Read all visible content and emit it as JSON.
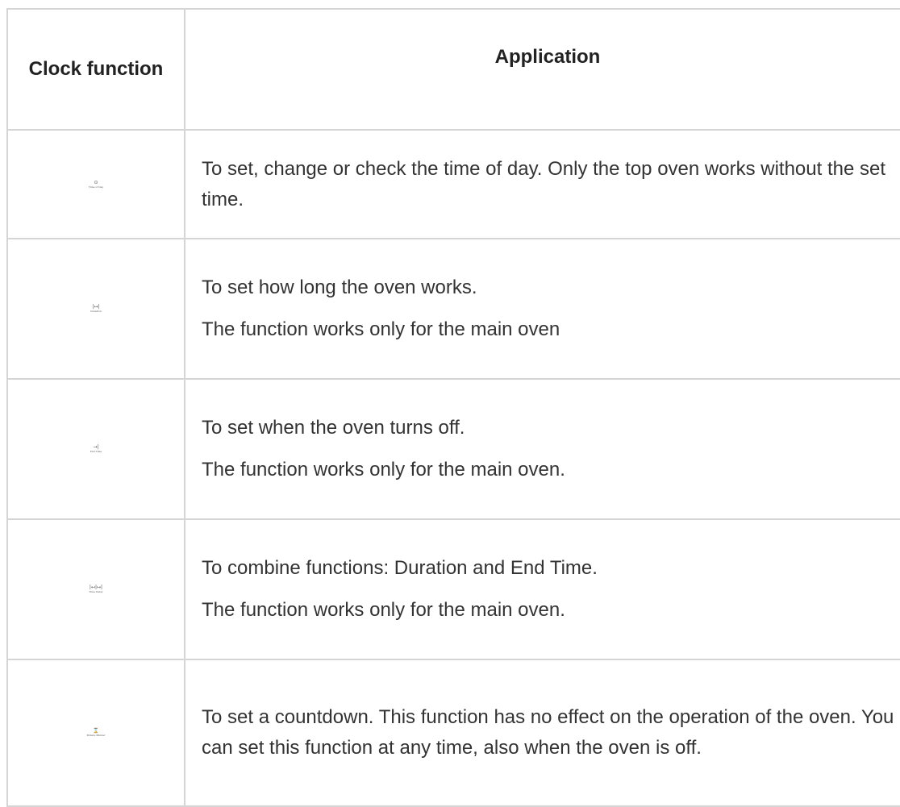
{
  "headers": {
    "clock_function": "Clock function",
    "application": "Application"
  },
  "rows": [
    {
      "icon": "clock-icon",
      "icon_glyph": "⊙",
      "icon_caption": "Time of Day",
      "lines": [
        "To set, change or check the time of day. Only the top oven works without the set time."
      ]
    },
    {
      "icon": "duration-icon",
      "icon_glyph": "|↦|",
      "icon_caption": "Duration",
      "lines": [
        "To set how long the oven works.",
        "The function works only for the main oven"
      ]
    },
    {
      "icon": "end-time-icon",
      "icon_glyph": "→|",
      "icon_caption": "End Time",
      "lines": [
        "To set when the oven turns off.",
        "The function works only for the main oven."
      ]
    },
    {
      "icon": "time-delay-icon",
      "icon_glyph": "|↤|↦|",
      "icon_caption": "Time Delay",
      "lines": [
        "To combine functions: Duration and End Time.",
        "The function works only for the main oven."
      ]
    },
    {
      "icon": "minute-minder-icon",
      "icon_glyph": "⌛",
      "icon_caption": "Minute Minder",
      "lines": [
        "To set a countdown. This function has no effect on the operation of the oven. You can set this function at any time, also when the oven is off."
      ]
    }
  ]
}
